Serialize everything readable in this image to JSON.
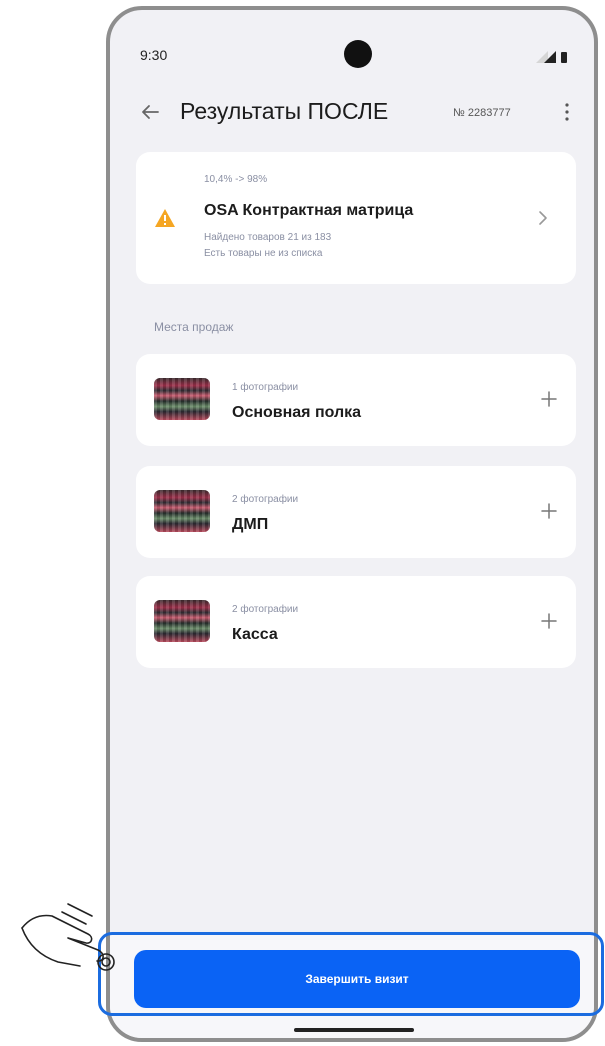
{
  "status_bar": {
    "time": "9:30"
  },
  "header": {
    "title": "Результаты ПОСЛЕ",
    "visit_number": "№ 2283777"
  },
  "osa_card": {
    "percent_change": "10,4% -> 98%",
    "title": "OSA Контрактная матрица",
    "found_text": "Найдено товаров 21 из 183",
    "note": "Есть товары не из списка"
  },
  "section_title": "Места продаж",
  "places": [
    {
      "count": "1 фотографии",
      "name": "Основная полка"
    },
    {
      "count": "2 фотографии",
      "name": "ДМП"
    },
    {
      "count": "2 фотографии",
      "name": "Касса"
    }
  ],
  "finish_button": {
    "label": "Завершить визит"
  },
  "colors": {
    "accent": "#0a63f5",
    "warning": "#f5a623",
    "highlight": "#1b6ce0"
  },
  "icons": [
    "back-arrow-icon",
    "more-vertical-icon",
    "warning-icon",
    "chevron-right-icon",
    "plus-icon",
    "pointing-hand-icon"
  ]
}
